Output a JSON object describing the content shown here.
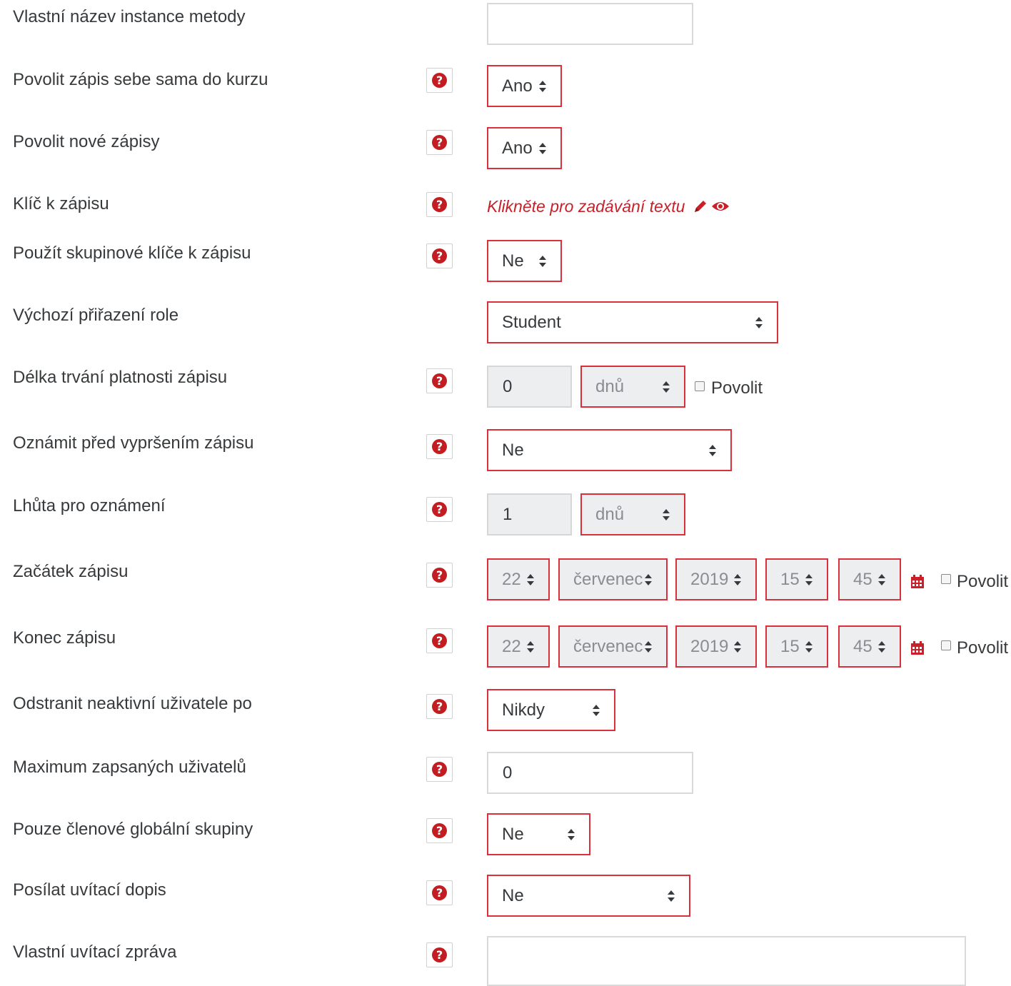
{
  "colors": {
    "accent": "#d9303b",
    "help": "#c41d21",
    "link": "#c9202a",
    "disabled_bg": "#eceeef"
  },
  "fields": {
    "instance_name": {
      "label": "Vlastní název instance metody",
      "value": ""
    },
    "self_enrol": {
      "label": "Povolit zápis sebe sama do kurzu",
      "value": "Ano"
    },
    "new_enrols": {
      "label": "Povolit nové zápisy",
      "value": "Ano"
    },
    "enrol_key": {
      "label": "Klíč k zápisu",
      "link": "Klikněte pro zadávání textu",
      "icons": [
        "pencil-icon",
        "eye-icon"
      ]
    },
    "group_keys": {
      "label": "Použít skupinové klíče k zápisu",
      "value": "Ne"
    },
    "default_role": {
      "label": "Výchozí přiřazení role",
      "value": "Student"
    },
    "enrol_period": {
      "label": "Délka trvání platnosti zápisu",
      "number": "0",
      "unit": "dnů",
      "enable_label": "Povolit",
      "enabled": false
    },
    "expiry_notify": {
      "label": "Oznámit před vypršením zápisu",
      "value": "Ne"
    },
    "notify_threshold": {
      "label": "Lhůta pro oznámení",
      "number": "1",
      "unit": "dnů"
    },
    "enrol_start": {
      "label": "Začátek zápisu",
      "day": "22",
      "month": "červenec",
      "year": "2019",
      "hour": "15",
      "minute": "45",
      "enable_label": "Povolit",
      "enabled": false
    },
    "enrol_end": {
      "label": "Konec zápisu",
      "day": "22",
      "month": "červenec",
      "year": "2019",
      "hour": "15",
      "minute": "45",
      "enable_label": "Povolit",
      "enabled": false
    },
    "unenrol_inactive": {
      "label": "Odstranit neaktivní uživatele po",
      "value": "Nikdy"
    },
    "max_enrolled": {
      "label": "Maximum zapsaných uživatelů",
      "value": "0"
    },
    "cohort_only": {
      "label": "Pouze členové globální skupiny",
      "value": "Ne"
    },
    "welcome_mail": {
      "label": "Posílat uvítací dopis",
      "value": "Ne"
    },
    "welcome_message": {
      "label": "Vlastní uvítací zpráva",
      "value": ""
    }
  },
  "help_icon": "question-circle-icon",
  "calendar_icon": "calendar-icon"
}
